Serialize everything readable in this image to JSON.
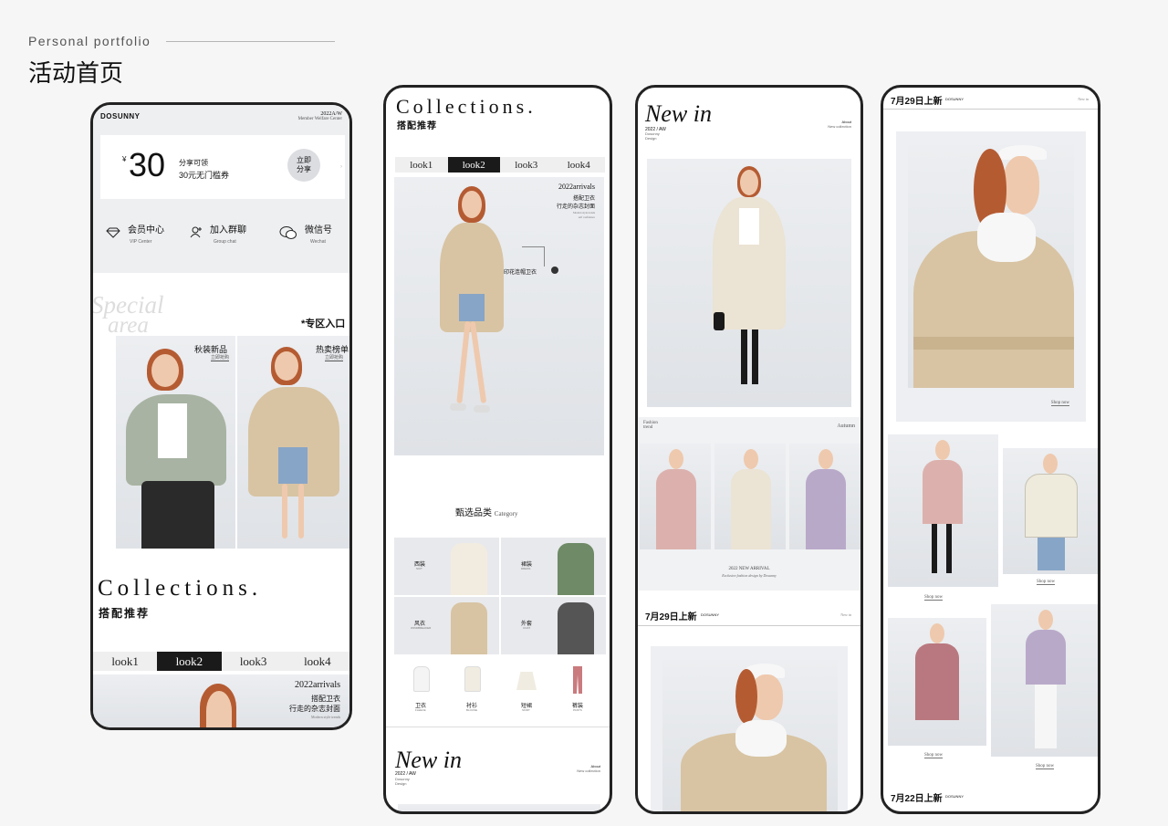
{
  "header": {
    "subtitle": "Personal portfolio",
    "title": "活动首页"
  },
  "phone1": {
    "brand": "DOSUNNY",
    "season": "2022A/W",
    "member_center": "Member Welfare Center",
    "coupon": {
      "currency": "¥",
      "amount": "30",
      "line1": "分享可领",
      "line2": "30元无门槛券",
      "button_line1": "立即",
      "button_line2": "分享"
    },
    "services": [
      {
        "icon": "diamond-icon",
        "label": "会员中心",
        "en": "VIP Center"
      },
      {
        "icon": "person-plus-icon",
        "label": "加入群聊",
        "en": "Group chat"
      },
      {
        "icon": "wechat-icon",
        "label": "微信号",
        "en": "Wechat"
      }
    ],
    "special_word1": "Special",
    "special_word2": "area",
    "zone_entry": "*专区入口",
    "cards": [
      {
        "title": "秋装新品",
        "sub": "立即抢购"
      },
      {
        "title": "热卖榜单",
        "sub": "立即抢购"
      }
    ],
    "collections": "Collections.",
    "collections_cn": "搭配推荐",
    "tabs": [
      "look1",
      "look2",
      "look3",
      "look4"
    ],
    "active_tab": "look2",
    "arrivals": "2022arrivals",
    "arr_line1": "搭配卫衣",
    "arr_line2": "行走的杂志封面",
    "arr_small": "Modern style trends"
  },
  "phone2": {
    "collections": "Collections.",
    "collections_cn": "搭配推荐",
    "tabs": [
      "look1",
      "look2",
      "look3",
      "look4"
    ],
    "active_tab": "look2",
    "arrivals": "2022arrivals",
    "arr_line1": "搭配卫衣",
    "arr_line2": "行走的杂志封面",
    "arr_small1": "Modern style trends",
    "arr_small2": "self confidence",
    "tag": "印花连帽卫衣",
    "category_cn": "甄选品类",
    "category_en": "Category",
    "cat_grid": [
      {
        "cn": "西装",
        "en": "SUIT"
      },
      {
        "cn": "裙装",
        "en": "DRESS"
      },
      {
        "cn": "风衣",
        "en": "WINDBREAKER"
      },
      {
        "cn": "外套",
        "en": "COAT"
      }
    ],
    "cat_icons": [
      {
        "cn": "卫衣",
        "en": "FLEECE"
      },
      {
        "cn": "衬衫",
        "en": "BLOUSE"
      },
      {
        "cn": "短裙",
        "en": "SKIRT"
      },
      {
        "cn": "裤装",
        "en": "PANTS"
      }
    ],
    "newin": "New in",
    "newin_sub1": "2022 / AW",
    "newin_sub2": "Dosunny",
    "newin_sub3": "Design",
    "about": "About",
    "about2": "New collection"
  },
  "phone3": {
    "newin": "New in",
    "newin_sub1": "2022 / AW",
    "newin_sub2": "Dosunny",
    "newin_sub3": "Design",
    "about": "About",
    "about2": "New collection",
    "fashion1": "Fashion",
    "fashion2": "trend",
    "autumn": "Autumn",
    "arrival1": "2022 NEW ARRIVAL",
    "arrival2": "Exclusive fashion design by Dosunny",
    "date_title": "7月29日上新",
    "date_brand": "DOSUNNY",
    "newin_small": "New in"
  },
  "phone4": {
    "date_title": "7月29日上新",
    "date_brand": "DOSUNNY",
    "newin_small": "New in",
    "shop_now": "Shop now",
    "date_title2": "7月22日上新",
    "date_brand2": "DOSUNNY"
  }
}
